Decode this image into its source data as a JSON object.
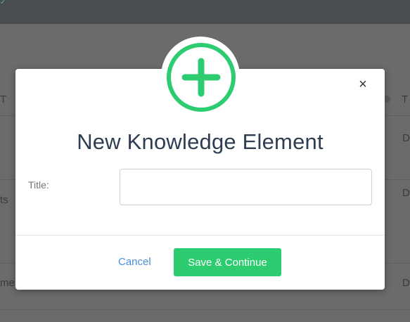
{
  "modal": {
    "title": "New Knowledge Element",
    "close_symbol": "×",
    "fields": {
      "title_label": "Title:",
      "title_value": ""
    },
    "actions": {
      "cancel_label": "Cancel",
      "save_label": "Save & Continue"
    },
    "accent_color": "#2ecc71",
    "icon": "plus-circle-icon"
  },
  "background": {
    "fragments": [
      "T",
      "T",
      "D",
      "ts",
      "D",
      "me",
      "D"
    ]
  }
}
